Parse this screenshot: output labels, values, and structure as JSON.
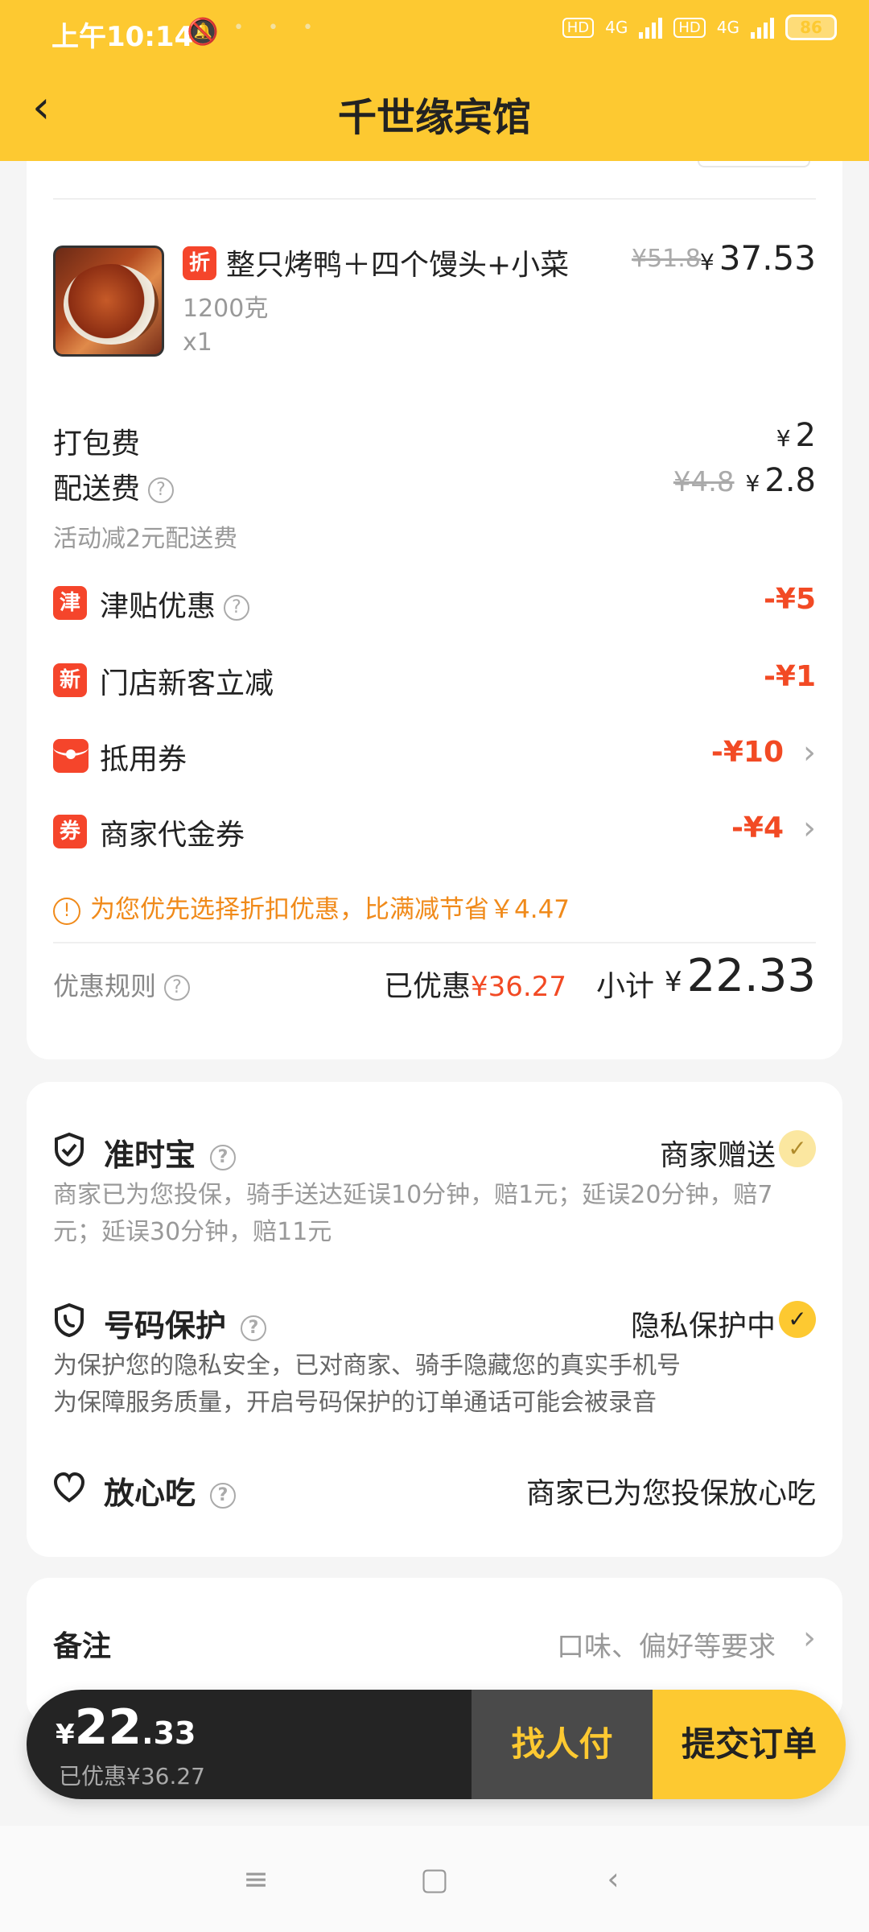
{
  "status_bar": {
    "time": "上午10:14",
    "network_1": "4G",
    "network_2": "4G",
    "hd": "HD",
    "battery": "86"
  },
  "header": {
    "title": "千世缘宾馆"
  },
  "product": {
    "badge": "折",
    "name": "整只烤鸭＋四个馒头+小菜",
    "original_price": "¥51.8",
    "price_currency": "¥",
    "price": "37.53",
    "spec": "1200克",
    "quantity": "x1"
  },
  "fees": {
    "packing_label": "打包费",
    "packing_currency": "¥",
    "packing_value": "2",
    "delivery_label": "配送费",
    "delivery_original": "¥4.8",
    "delivery_currency": "¥",
    "delivery_value": "2.8",
    "delivery_note": "活动减2元配送费"
  },
  "discounts": [
    {
      "badge": "津",
      "label": "津贴优惠",
      "value": "-¥5",
      "has_help": true
    },
    {
      "badge": "新",
      "label": "门店新客立减",
      "value": "-¥1"
    },
    {
      "label": "抵用券",
      "value": "-¥10"
    },
    {
      "badge": "券",
      "label": "商家代金券",
      "value": "-¥4"
    }
  ],
  "tip": "为您优先选择折扣优惠，比满减节省￥4.47",
  "summary": {
    "rules_label": "优惠规则",
    "saved_label": "已优惠",
    "saved_value": "¥36.27",
    "subtotal_label": "小计",
    "subtotal_currency": "¥",
    "subtotal_value": "22.33"
  },
  "services": {
    "ontime": {
      "title": "准时宝",
      "status": "商家赠送",
      "desc": "商家已为您投保，骑手送达延误10分钟，赔1元；延误20分钟，赔7元；延误30分钟，赔11元"
    },
    "privacy": {
      "title": "号码保护",
      "status": "隐私保护中",
      "desc_1": "为保护您的隐私安全，已对商家、骑手隐藏您的真实手机号",
      "desc_2": "为保障服务质量，开启号码保护的订单通话可能会被录音"
    },
    "safe_eat": {
      "title": "放心吃",
      "status": "商家已为您投保放心吃"
    }
  },
  "remark": {
    "label": "备注",
    "hint": "口味、偏好等要求"
  },
  "paybar": {
    "currency": "¥",
    "total_int": "22",
    "total_dec": ".33",
    "saved": "已优惠¥36.27",
    "friend_pay": "找人付",
    "submit": "提交订单"
  },
  "colors": {
    "brand_yellow": "#fdc931",
    "discount_red": "#f24a24",
    "tip_orange": "#f08a1a"
  }
}
